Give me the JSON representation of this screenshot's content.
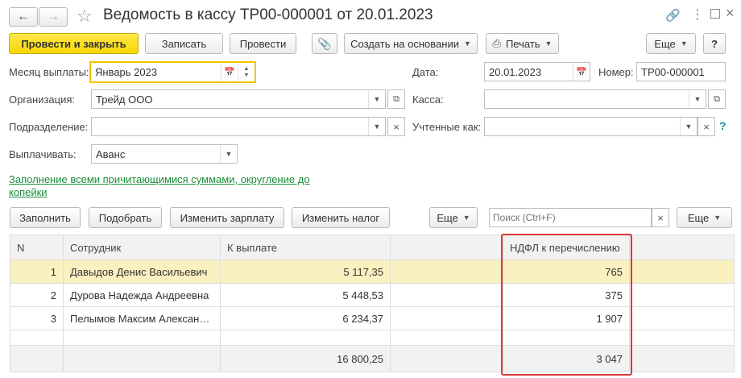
{
  "title": "Ведомость в кассу ТР00-000001 от 20.01.2023",
  "toolbar": {
    "post_close": "Провести и закрыть",
    "save": "Записать",
    "post": "Провести",
    "create_based": "Создать на основании",
    "print": "Печать",
    "more": "Еще",
    "help": "?"
  },
  "form": {
    "month_label": "Месяц выплаты:",
    "month_value": "Январь 2023",
    "date_label": "Дата:",
    "date_value": "20.01.2023",
    "number_label": "Номер:",
    "number_value": "ТР00-000001",
    "org_label": "Организация:",
    "org_value": "Трейд ООО",
    "cash_label": "Касса:",
    "cash_value": "",
    "dept_label": "Подразделение:",
    "dept_value": "",
    "accounted_label": "Учтенные как:",
    "accounted_value": "",
    "pay_label": "Выплачивать:",
    "pay_value": "Аванс",
    "fill_link": "Заполнение всеми причитающимися суммами, округление до копейки"
  },
  "table_toolbar": {
    "fill": "Заполнить",
    "select": "Подобрать",
    "change_salary": "Изменить зарплату",
    "change_tax": "Изменить налог",
    "more": "Еще",
    "search_placeholder": "Поиск (Ctrl+F)",
    "more2": "Еще"
  },
  "table": {
    "columns": [
      "N",
      "Сотрудник",
      "К выплате",
      "",
      "НДФЛ к перечислению"
    ],
    "rows": [
      {
        "n": "1",
        "employee": "Давыдов Денис Васильевич",
        "amount": "5 117,35",
        "ndfl": "765"
      },
      {
        "n": "2",
        "employee": "Дурова Надежда Андреевна",
        "amount": "5 448,53",
        "ndfl": "375"
      },
      {
        "n": "3",
        "employee": "Пелымов Максим Алексан…",
        "amount": "6 234,37",
        "ndfl": "1 907"
      }
    ],
    "total_amount": "16 800,25",
    "total_ndfl": "3 047"
  },
  "colors": {
    "primary_button": "#f7d500",
    "link": "#1a8c3a",
    "highlight": "#d9393b",
    "selected_row": "#fbf0c0"
  }
}
